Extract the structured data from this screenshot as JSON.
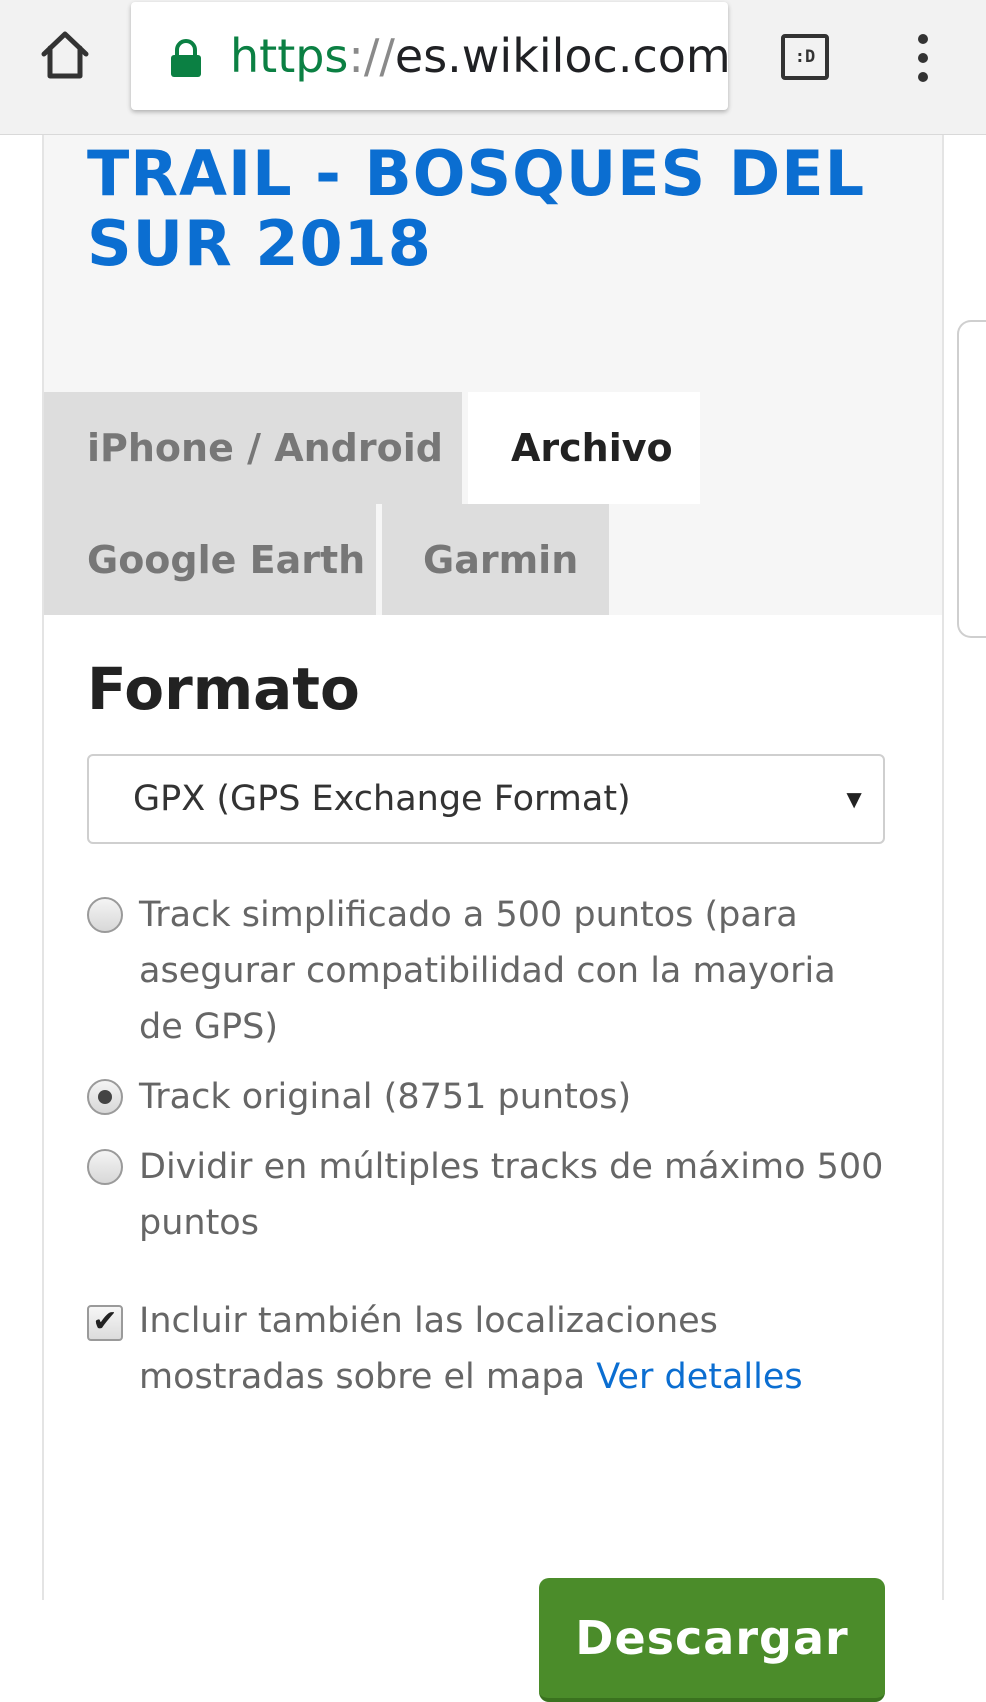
{
  "browser": {
    "url_scheme": "https",
    "url_separator": "://",
    "url_host": "es.wikiloc.com",
    "tab_switcher_label": ":D",
    "icons": [
      "home-icon",
      "lock-icon",
      "tab-switcher-icon",
      "overflow-menu-icon"
    ],
    "lock_color": "#0b8043"
  },
  "page": {
    "title": "TRAIL - BOSQUES DEL SUR 2018",
    "title_color": "#0b6ed1",
    "tabs": [
      {
        "label": "iPhone / Android",
        "active": false
      },
      {
        "label": "Archivo",
        "active": true
      },
      {
        "label": "Google Earth",
        "active": false
      },
      {
        "label": "Garmin",
        "active": false
      }
    ],
    "section_heading": "Formato",
    "format_select": {
      "selected": "GPX (GPS Exchange Format)"
    },
    "options": [
      {
        "label": "Track simplificado a 500 puntos (para asegurar compatibilidad con la mayoria de GPS)",
        "checked": false
      },
      {
        "label": "Track original (8751 puntos)",
        "checked": true
      },
      {
        "label": "Dividir en múltiples tracks de máximo 500 puntos",
        "checked": false
      }
    ],
    "include_locations": {
      "label": "Incluir también las localizaciones mostradas sobre el mapa",
      "link": "Ver detalles",
      "checked": true
    },
    "download_button": "Descargar",
    "download_color": "#4b8c2a"
  }
}
